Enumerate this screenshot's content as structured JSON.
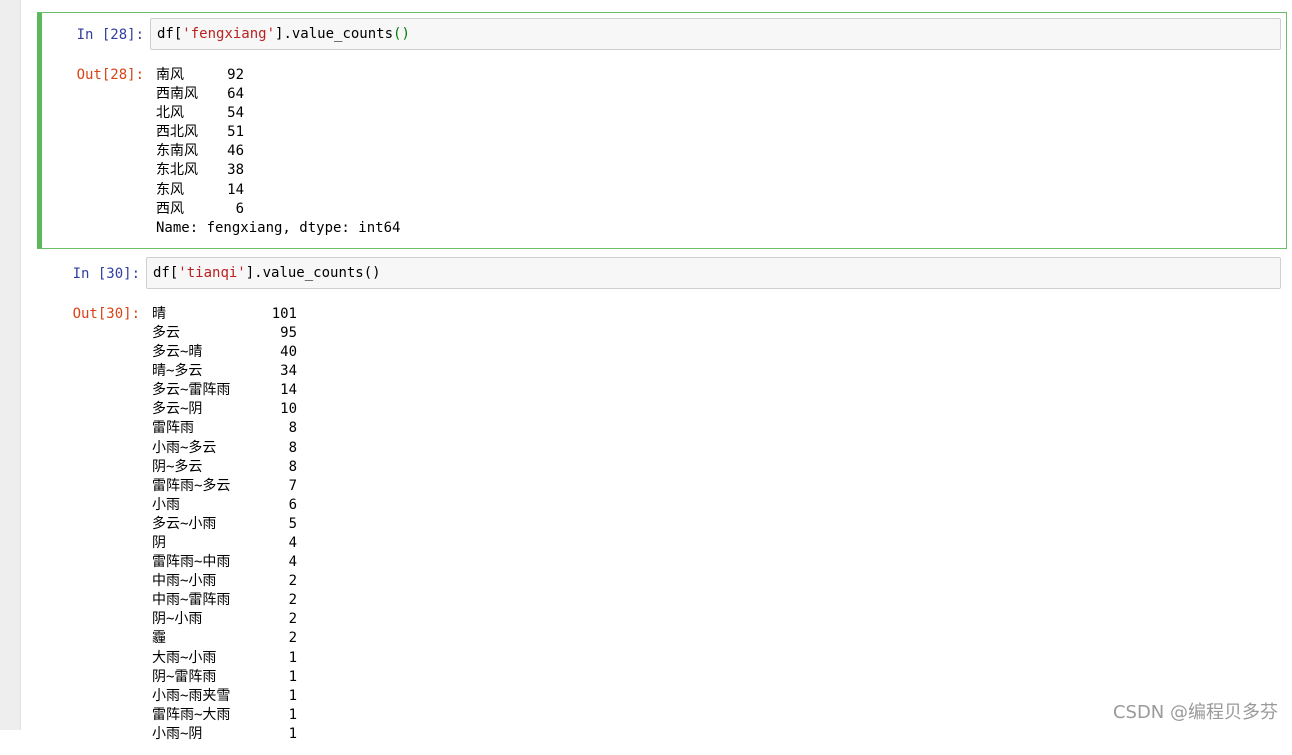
{
  "cells": [
    {
      "in_prompt": "In  [28]:",
      "code": {
        "prefix": "df[",
        "string": "'fengxiang'",
        "middle": "].value_counts",
        "parens": "()"
      },
      "out_prompt": "Out[28]:",
      "output": [
        {
          "key": "南风",
          "value": "92"
        },
        {
          "key": "西南风",
          "value": "64"
        },
        {
          "key": "北风",
          "value": "54"
        },
        {
          "key": "西北风",
          "value": "51"
        },
        {
          "key": "东南风",
          "value": "46"
        },
        {
          "key": "东北风",
          "value": "38"
        },
        {
          "key": "东风",
          "value": "14"
        },
        {
          "key": "西风",
          "value": "6"
        }
      ],
      "footer": "Name: fengxiang, dtype: int64"
    },
    {
      "in_prompt": "In  [30]:",
      "code": {
        "prefix": "df[",
        "string": "'tianqi'",
        "middle": "].value_counts",
        "parens": "()"
      },
      "out_prompt": "Out[30]:",
      "output": [
        {
          "key": "晴",
          "value": "101"
        },
        {
          "key": "多云",
          "value": "95"
        },
        {
          "key": "多云~晴",
          "value": "40"
        },
        {
          "key": "晴~多云",
          "value": "34"
        },
        {
          "key": "多云~雷阵雨",
          "value": "14"
        },
        {
          "key": "多云~阴",
          "value": "10"
        },
        {
          "key": "雷阵雨",
          "value": "8"
        },
        {
          "key": "小雨~多云",
          "value": "8"
        },
        {
          "key": "阴~多云",
          "value": "8"
        },
        {
          "key": "雷阵雨~多云",
          "value": "7"
        },
        {
          "key": "小雨",
          "value": "6"
        },
        {
          "key": "多云~小雨",
          "value": "5"
        },
        {
          "key": "阴",
          "value": "4"
        },
        {
          "key": "雷阵雨~中雨",
          "value": "4"
        },
        {
          "key": "中雨~小雨",
          "value": "2"
        },
        {
          "key": "中雨~雷阵雨",
          "value": "2"
        },
        {
          "key": "阴~小雨",
          "value": "2"
        },
        {
          "key": "霾",
          "value": "2"
        },
        {
          "key": "大雨~小雨",
          "value": "1"
        },
        {
          "key": "阴~雷阵雨",
          "value": "1"
        },
        {
          "key": "小雨~雨夹雪",
          "value": "1"
        },
        {
          "key": "雷阵雨~大雨",
          "value": "1"
        },
        {
          "key": "小雨~阴",
          "value": "1"
        }
      ]
    }
  ],
  "watermark": "CSDN @编程贝多芬",
  "colors": {
    "selected_border": "#5cb85c",
    "in_prompt": "#303f9f",
    "out_prompt": "#d84315",
    "string": "#ba2121"
  }
}
